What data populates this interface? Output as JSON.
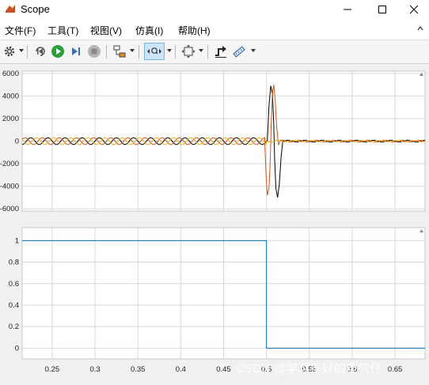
{
  "window": {
    "title": "Scope"
  },
  "menu": {
    "items": [
      "文件(F)",
      "工具(T)",
      "视图(V)",
      "仿真(I)",
      "帮助(H)"
    ]
  },
  "toolbar": {
    "icons": [
      "gear-icon",
      "step-back-icon",
      "run-icon",
      "step-forward-icon",
      "stop-icon",
      "layout-icon",
      "zoom-x-icon",
      "autoscale-icon",
      "cursor-measure-icon",
      "signal-measure-icon"
    ]
  },
  "colors": {
    "series1": "#000000",
    "series2": "#d95319",
    "series3": "#0072bd",
    "grid": "#d8d8d8",
    "axes_bg": "#ffffff"
  },
  "chart_data": [
    {
      "type": "line",
      "xlim": [
        0.215,
        0.685
      ],
      "ylim": [
        -6200,
        6200
      ],
      "yticks": [
        6000,
        4000,
        2000,
        0,
        -2000,
        -4000,
        -6000
      ],
      "ytick_labels": [
        "6000",
        "4000",
        "2000",
        "0",
        "-2000",
        "-4000",
        "-6000"
      ],
      "grid": true,
      "series": [
        {
          "color": "#000000",
          "segments": [
            {
              "kind": "sine",
              "x0": 0.215,
              "x1": 0.501,
              "amplitude": 300,
              "freq": 50,
              "phase": 0
            },
            {
              "kind": "points",
              "xy": [
                [
                  0.501,
                  0
                ],
                [
                  0.503,
                  3200
                ],
                [
                  0.505,
                  4900
                ],
                [
                  0.507,
                  4200
                ],
                [
                  0.5085,
                  1500
                ],
                [
                  0.5095,
                  -1500
                ],
                [
                  0.511,
                  -4200
                ],
                [
                  0.513,
                  -5000
                ],
                [
                  0.515,
                  -3800
                ],
                [
                  0.517,
                  -1500
                ],
                [
                  0.519,
                  0
                ]
              ]
            },
            {
              "kind": "sine",
              "x0": 0.519,
              "x1": 0.685,
              "amplitude": 80,
              "freq": 50,
              "phase": 0
            }
          ]
        },
        {
          "color": "#d95319",
          "segments": [
            {
              "kind": "sine",
              "x0": 0.215,
              "x1": 0.498,
              "amplitude": 300,
              "freq": 50,
              "phase": 2.094
            },
            {
              "kind": "points",
              "xy": [
                [
                  0.498,
                  0
                ],
                [
                  0.4995,
                  -3000
                ],
                [
                  0.501,
                  -4800
                ],
                [
                  0.503,
                  -4100
                ],
                [
                  0.5045,
                  -1500
                ],
                [
                  0.5055,
                  1500
                ],
                [
                  0.507,
                  4200
                ],
                [
                  0.5085,
                  5000
                ],
                [
                  0.51,
                  3800
                ],
                [
                  0.512,
                  1200
                ],
                [
                  0.514,
                  -300
                ],
                [
                  0.516,
                  0
                ]
              ]
            },
            {
              "kind": "sine",
              "x0": 0.516,
              "x1": 0.685,
              "amplitude": 80,
              "freq": 50,
              "phase": 2.094
            }
          ]
        },
        {
          "color": "#edb120",
          "segments": [
            {
              "kind": "sine",
              "x0": 0.215,
              "x1": 0.5,
              "amplitude": 300,
              "freq": 50,
              "phase": 4.189
            },
            {
              "kind": "points",
              "xy": [
                [
                  0.5,
                  0
                ],
                [
                  0.506,
                  -150
                ],
                [
                  0.512,
                  100
                ],
                [
                  0.517,
                  0
                ]
              ]
            },
            {
              "kind": "sine",
              "x0": 0.517,
              "x1": 0.685,
              "amplitude": 60,
              "freq": 50,
              "phase": 4.189
            }
          ]
        }
      ]
    },
    {
      "type": "line",
      "xlim": [
        0.215,
        0.685
      ],
      "ylim": [
        -0.1,
        1.12
      ],
      "yticks": [
        1,
        0.8,
        0.6,
        0.4,
        0.2,
        0
      ],
      "ytick_labels": [
        "1",
        "0.8",
        "0.6",
        "0.4",
        "0.2",
        "0"
      ],
      "xticks": [
        0.25,
        0.3,
        0.35,
        0.4,
        0.45,
        0.5,
        0.55,
        0.6,
        0.65
      ],
      "xtick_labels": [
        "0.25",
        "0.3",
        "0.35",
        "0.4",
        "0.45",
        "0.5",
        "0.55",
        "0.6",
        "0.65"
      ],
      "grid": true,
      "series": [
        {
          "color": "#0072bd",
          "x": [
            0.215,
            0.5,
            0.5,
            0.685
          ],
          "y": [
            1,
            1,
            0,
            0
          ]
        }
      ]
    }
  ],
  "watermark": "CSDN @学习不好的电气仔"
}
